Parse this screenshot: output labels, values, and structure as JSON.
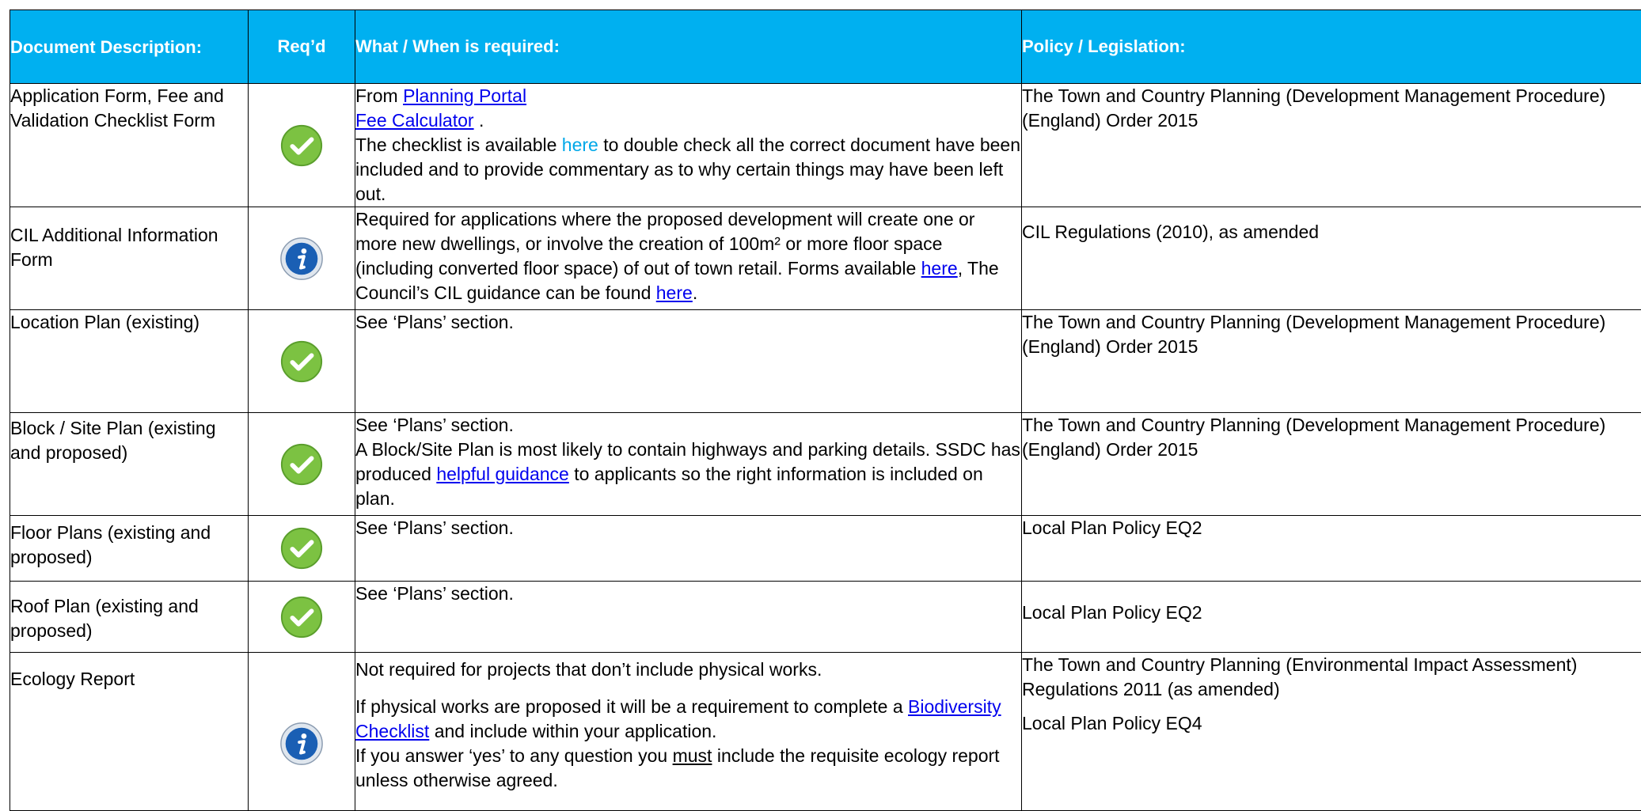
{
  "header": {
    "desc": "Document Description:",
    "req": "Req’d",
    "what": "What / When is required:",
    "policy": "Policy / Legislation:"
  },
  "rows": [
    {
      "desc": "Application Form, Fee and Validation Checklist Form",
      "icon": "check-icon",
      "what": {
        "from": "From ",
        "link1": "Planning Portal",
        "link2": "Fee Calculator",
        "dot": " .",
        "t1": "The checklist is available ",
        "here": "here",
        "t2": " to double check all the correct document have been included and to provide commentary as to why certain things may have been left out."
      },
      "policy": "The Town and Country Planning (Development Management Procedure) (England) Order 2015"
    },
    {
      "desc": "CIL Additional Information Form",
      "icon": "info-icon",
      "what": {
        "t1": "Required for applications where the proposed development will create one or more new dwellings, or involve the creation of 100m² or more floor space (including converted floor space) of out of town retail. Forms available ",
        "here1": "here",
        "t2": ", The Council’s CIL guidance can be found ",
        "here2": "here",
        "t3": "."
      },
      "policy": "CIL Regulations (2010), as amended"
    },
    {
      "desc": "Location Plan (existing)",
      "icon": "check-icon",
      "what": {
        "t1": "See ‘Plans’ section."
      },
      "policy": "The Town and Country Planning (Development Management Procedure) (England) Order 2015"
    },
    {
      "desc": "Block / Site Plan (existing and proposed)",
      "icon": "check-icon",
      "what": {
        "t1": "See ‘Plans’ section.",
        "t2": "A Block/Site Plan is most likely to contain highways and parking details. SSDC has produced ",
        "link": "helpful guidance",
        "t3": " to applicants so the right information is included on plan."
      },
      "policy": "The Town and Country Planning (Development Management Procedure) (England) Order 2015"
    },
    {
      "desc": "Floor Plans (existing and proposed)",
      "icon": "check-icon",
      "what": {
        "t1": "See ‘Plans’ section."
      },
      "policy": "Local Plan Policy EQ2"
    },
    {
      "desc": "Roof Plan (existing and proposed)",
      "icon": "check-icon",
      "what": {
        "t1": "See ‘Plans’ section."
      },
      "policy": "Local Plan Policy EQ2"
    },
    {
      "desc": "Ecology Report",
      "icon": "info-icon",
      "what": {
        "t1": "Not required for projects that don’t include physical works.",
        "t2": "If physical works are proposed it will be a requirement to complete a ",
        "link": "Biodiversity Checklist",
        "t3": " and include within your application.",
        "t4": "If you answer ‘yes’ to any question you ",
        "must": "must",
        "t5": " include the requisite ecology report unless otherwise agreed."
      },
      "policy": "The Town and Country Planning (Environmental Impact Assessment) Regulations 2011 (as amended)",
      "policy2": "Local Plan Policy EQ4"
    }
  ],
  "colors": {
    "header_bg": "#00b0f0",
    "link": "#0000ee",
    "check_green": "#7cc242",
    "info_blue": "#1a5fb4"
  }
}
